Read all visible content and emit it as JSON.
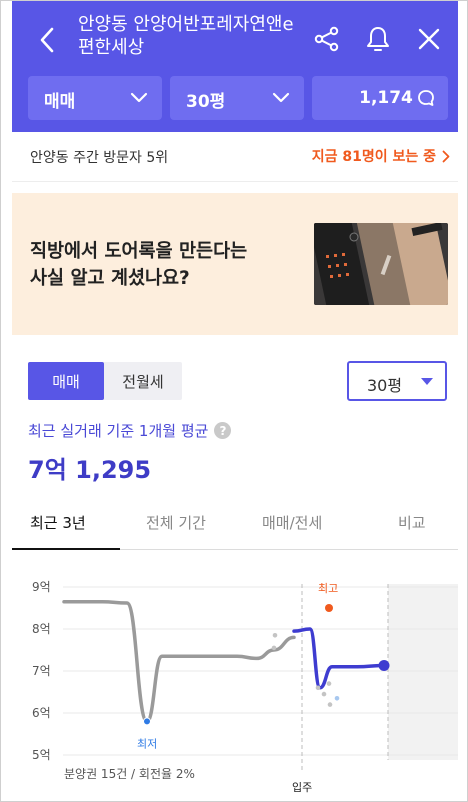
{
  "header": {
    "title": "안양동 안양어반포레자연앤e편한세상",
    "filters": {
      "trade": "매매",
      "size": "30평",
      "count": "1,174"
    },
    "colors": {
      "bg": "#5856e6",
      "filter_bg": "#6f6df0"
    }
  },
  "visitors": {
    "rank_text": "안양동 주간 방문자 5위",
    "live_text": "지금 81명이 보는 중",
    "live_color": "#f05a1e"
  },
  "banner": {
    "line1": "직방에서 도어록을 만든다는",
    "line2": "사실 알고 계셨나요?"
  },
  "trade": {
    "seg_sale": "매매",
    "seg_rent": "전월세",
    "size": "30평",
    "avg_label": "최근 실거래 기준 1개월 평균",
    "avg_price": "7억 1,295"
  },
  "tabs": [
    "최근 3년",
    "전체 기간",
    "매매/전세",
    "비교"
  ],
  "chart_data": {
    "type": "line",
    "y_ticks": [
      "9억",
      "8억",
      "7억",
      "6억",
      "5억"
    ],
    "ylim": [
      5,
      9
    ],
    "unit": "억",
    "series": [
      {
        "name": "분양권",
        "values": [
          8.65,
          8.65,
          8.62,
          5.8,
          7.35,
          7.35,
          7.35,
          7.3,
          7.5,
          7.8
        ]
      },
      {
        "name": "입주 이후",
        "values": [
          7.95,
          8.0,
          6.6,
          7.1,
          7.1,
          7.13
        ]
      }
    ],
    "scatter_points": [
      7.85,
      7.55,
      6.6,
      6.45,
      6.2,
      6.35,
      6.7
    ],
    "annotations": {
      "low": "최저",
      "high": "최고",
      "move_in": "입주"
    },
    "low_value": 5.8,
    "high_value": 8.5,
    "footnote": "분양권 15건 / 회전율 2%"
  }
}
